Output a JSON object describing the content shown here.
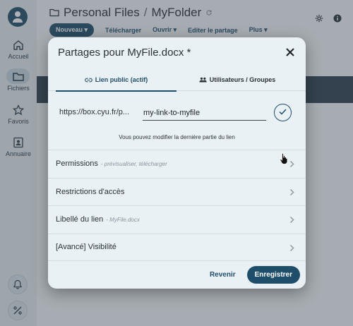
{
  "sidebar": {
    "items": [
      {
        "label": "Accueil",
        "icon": "home-icon"
      },
      {
        "label": "Fichiers",
        "icon": "folder-icon"
      },
      {
        "label": "Favoris",
        "icon": "star-icon"
      },
      {
        "label": "Annuaire",
        "icon": "contacts-icon"
      }
    ],
    "bottom_icons": [
      "bell-icon",
      "percent-icon"
    ]
  },
  "header": {
    "breadcrumb": [
      "Personal Files",
      "MyFolder"
    ],
    "separator": "/"
  },
  "toolbar": {
    "new_label": "Nouveau",
    "upload_label": "Télécharger",
    "open_label": "Ouvrir",
    "edit_share_label": "Editer le partage",
    "more_label": "Plus"
  },
  "modal": {
    "title": "Partages pour MyFile.docx *",
    "tabs": [
      {
        "label": "Lien public (actif)",
        "active": true
      },
      {
        "label": "Utilisateurs / Groupes",
        "active": false
      }
    ],
    "link_prefix": "https://box.cyu.fr/p...",
    "link_value": "my-link-to-myfile",
    "hint": "Vous pouvez modifier la dernière partie du lien",
    "rows": [
      {
        "label": "Permissions",
        "sub": "- prévisualiser, télécharger"
      },
      {
        "label": "Restrictions d'accès",
        "sub": ""
      },
      {
        "label": "Libellé du lien",
        "sub": "- MyFile.docx"
      },
      {
        "label": "[Avancé] Visibilité",
        "sub": ""
      }
    ],
    "cancel_label": "Revenir",
    "save_label": "Enregistrer"
  },
  "colors": {
    "primary": "#1f4e6a",
    "modal_bg": "#eaf1f5"
  }
}
